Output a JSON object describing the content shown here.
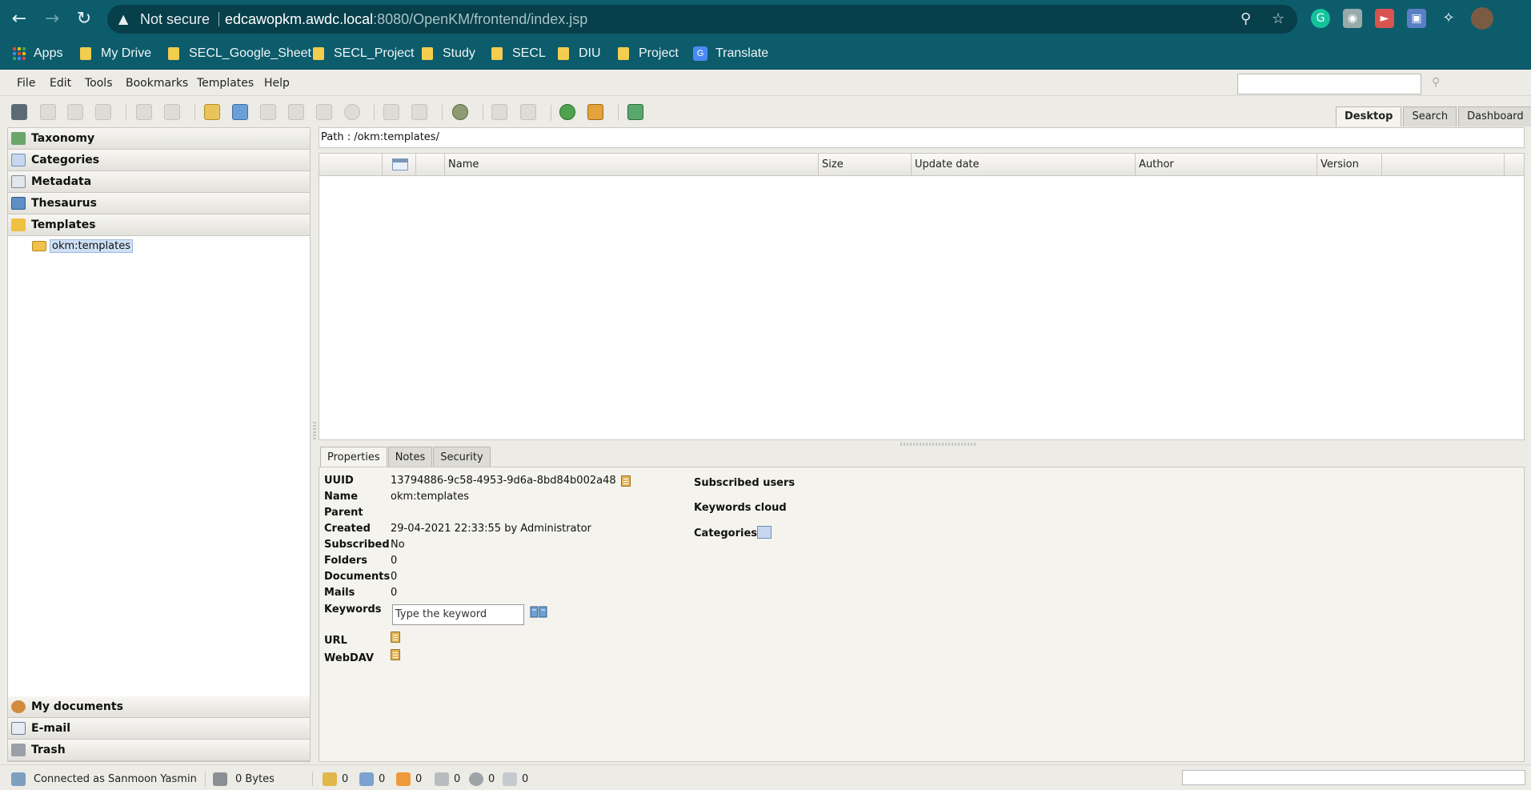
{
  "browser": {
    "security_label": "Not secure",
    "url_host": "edcawopkm.awdc.local",
    "url_rest": ":8080/OpenKM/frontend/index.jsp",
    "icons": [
      "back-icon",
      "forward-icon",
      "reload-icon",
      "warning-icon",
      "key-icon",
      "star-icon",
      "grammarly-icon",
      "camera-icon",
      "mute-icon",
      "screencast-icon",
      "extensions-icon",
      "profile-avatar"
    ]
  },
  "bookmarks": [
    {
      "label": "Apps"
    },
    {
      "label": "My Drive"
    },
    {
      "label": "SECL_Google_Sheet"
    },
    {
      "label": "SECL_Project"
    },
    {
      "label": "Study"
    },
    {
      "label": "SECL"
    },
    {
      "label": "DIU"
    },
    {
      "label": "Project"
    },
    {
      "label": "Translate"
    }
  ],
  "menu": [
    "File",
    "Edit",
    "Tools",
    "Bookmarks",
    "Templates",
    "Help"
  ],
  "view_tabs": [
    {
      "label": "Desktop",
      "active": true
    },
    {
      "label": "Search",
      "active": false
    },
    {
      "label": "Dashboard",
      "active": false
    }
  ],
  "left_stack": {
    "top_sections": [
      "Taxonomy",
      "Categories",
      "Metadata",
      "Thesaurus",
      "Templates"
    ],
    "tree_node": "okm:templates",
    "bottom_sections": [
      "My documents",
      "E-mail",
      "Trash"
    ]
  },
  "path": "Path : /okm:templates/",
  "grid_columns": [
    "Name",
    "Size",
    "Update date",
    "Author",
    "Version"
  ],
  "detail_tabs": [
    {
      "label": "Properties",
      "active": true
    },
    {
      "label": "Notes",
      "active": false
    },
    {
      "label": "Security",
      "active": false
    }
  ],
  "properties": {
    "uuid": {
      "label": "UUID",
      "value": "13794886-9c58-4953-9d6a-8bd84b002a48"
    },
    "name": {
      "label": "Name",
      "value": "okm:templates"
    },
    "parent": {
      "label": "Parent",
      "value": ""
    },
    "created": {
      "label": "Created",
      "value": "29-04-2021 22:33:55 by Administrator"
    },
    "subscribed": {
      "label": "Subscribed",
      "value": "No"
    },
    "folders": {
      "label": "Folders",
      "value": "0"
    },
    "documents": {
      "label": "Documents",
      "value": "0"
    },
    "mails": {
      "label": "Mails",
      "value": "0"
    },
    "keywords": {
      "label": "Keywords",
      "placeholder": "Type the keyword"
    },
    "url": {
      "label": "URL"
    },
    "webdav": {
      "label": "WebDAV"
    }
  },
  "right_labels": {
    "subscribed_users": "Subscribed users",
    "keywords_cloud": "Keywords cloud",
    "categories": "Categories"
  },
  "status": {
    "user": "Connected as Sanmoon Yasmin",
    "size": "0 Bytes",
    "counters": [
      "0",
      "0",
      "0",
      "0",
      "0",
      "0"
    ]
  },
  "colors": {
    "chrome": "#0c5c6c",
    "omnibox": "#073f4a",
    "selection": "#cfe0f5"
  }
}
